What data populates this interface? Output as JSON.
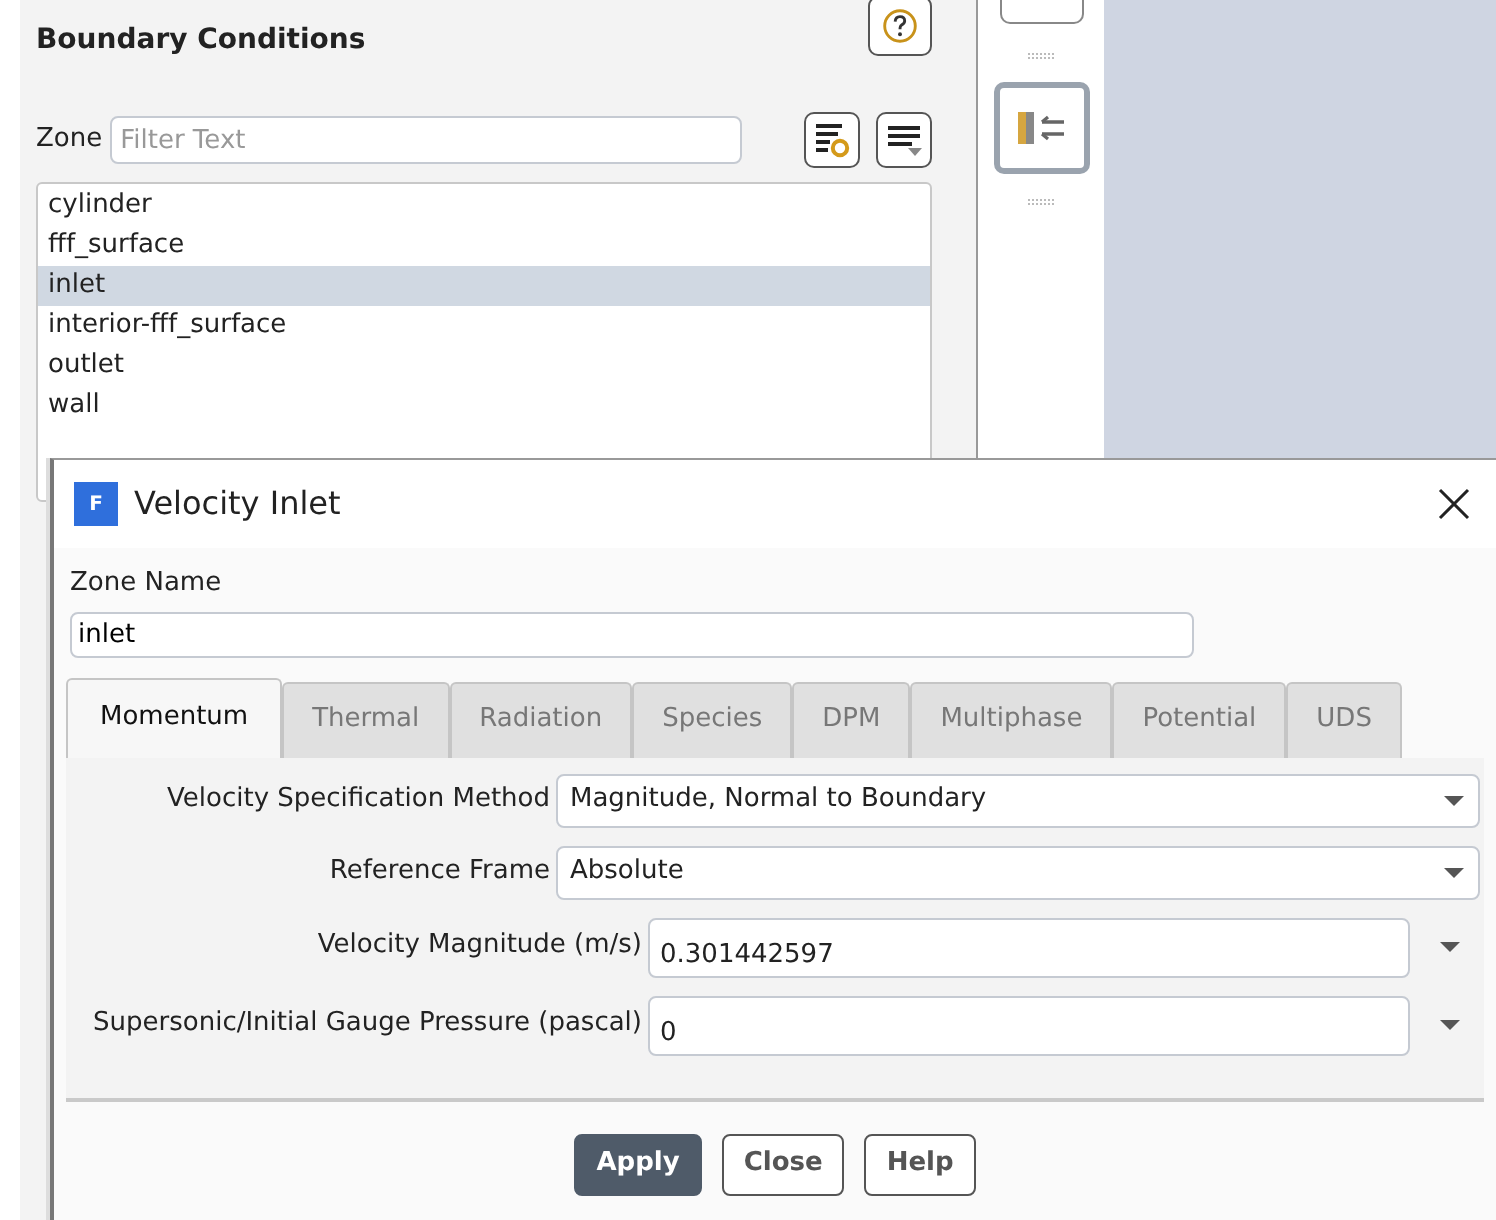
{
  "panel": {
    "title": "Boundary Conditions",
    "filter": {
      "label": "Zone",
      "placeholder": "Filter Text"
    },
    "zones": [
      {
        "label": "cylinder",
        "selected": false
      },
      {
        "label": "fff_surface",
        "selected": false
      },
      {
        "label": "inlet",
        "selected": true
      },
      {
        "label": "interior-fff_surface",
        "selected": false
      },
      {
        "label": "outlet",
        "selected": false
      },
      {
        "label": "wall",
        "selected": false
      }
    ]
  },
  "dialog": {
    "logo_letter": "F",
    "title": "Velocity Inlet",
    "zone_name": {
      "label": "Zone Name",
      "value": "inlet"
    },
    "tabs": [
      {
        "label": "Momentum",
        "selected": true
      },
      {
        "label": "Thermal",
        "selected": false
      },
      {
        "label": "Radiation",
        "selected": false
      },
      {
        "label": "Species",
        "selected": false
      },
      {
        "label": "DPM",
        "selected": false
      },
      {
        "label": "Multiphase",
        "selected": false
      },
      {
        "label": "Potential",
        "selected": false
      },
      {
        "label": "UDS",
        "selected": false
      }
    ],
    "fields": [
      {
        "kind": "dropdown",
        "label": "Velocity Specification Method",
        "value": "Magnitude, Normal to Boundary"
      },
      {
        "kind": "dropdown",
        "label": "Reference Frame",
        "value": "Absolute"
      },
      {
        "kind": "input",
        "label": "Velocity Magnitude (m/s)",
        "value": "0.301442597"
      },
      {
        "kind": "input",
        "label": "Supersonic/Initial Gauge Pressure (pascal)",
        "value": "0"
      }
    ],
    "buttons": [
      {
        "label": "Apply",
        "kind": "primary"
      },
      {
        "label": "Close",
        "kind": "default"
      },
      {
        "label": "Help",
        "kind": "default"
      }
    ]
  }
}
